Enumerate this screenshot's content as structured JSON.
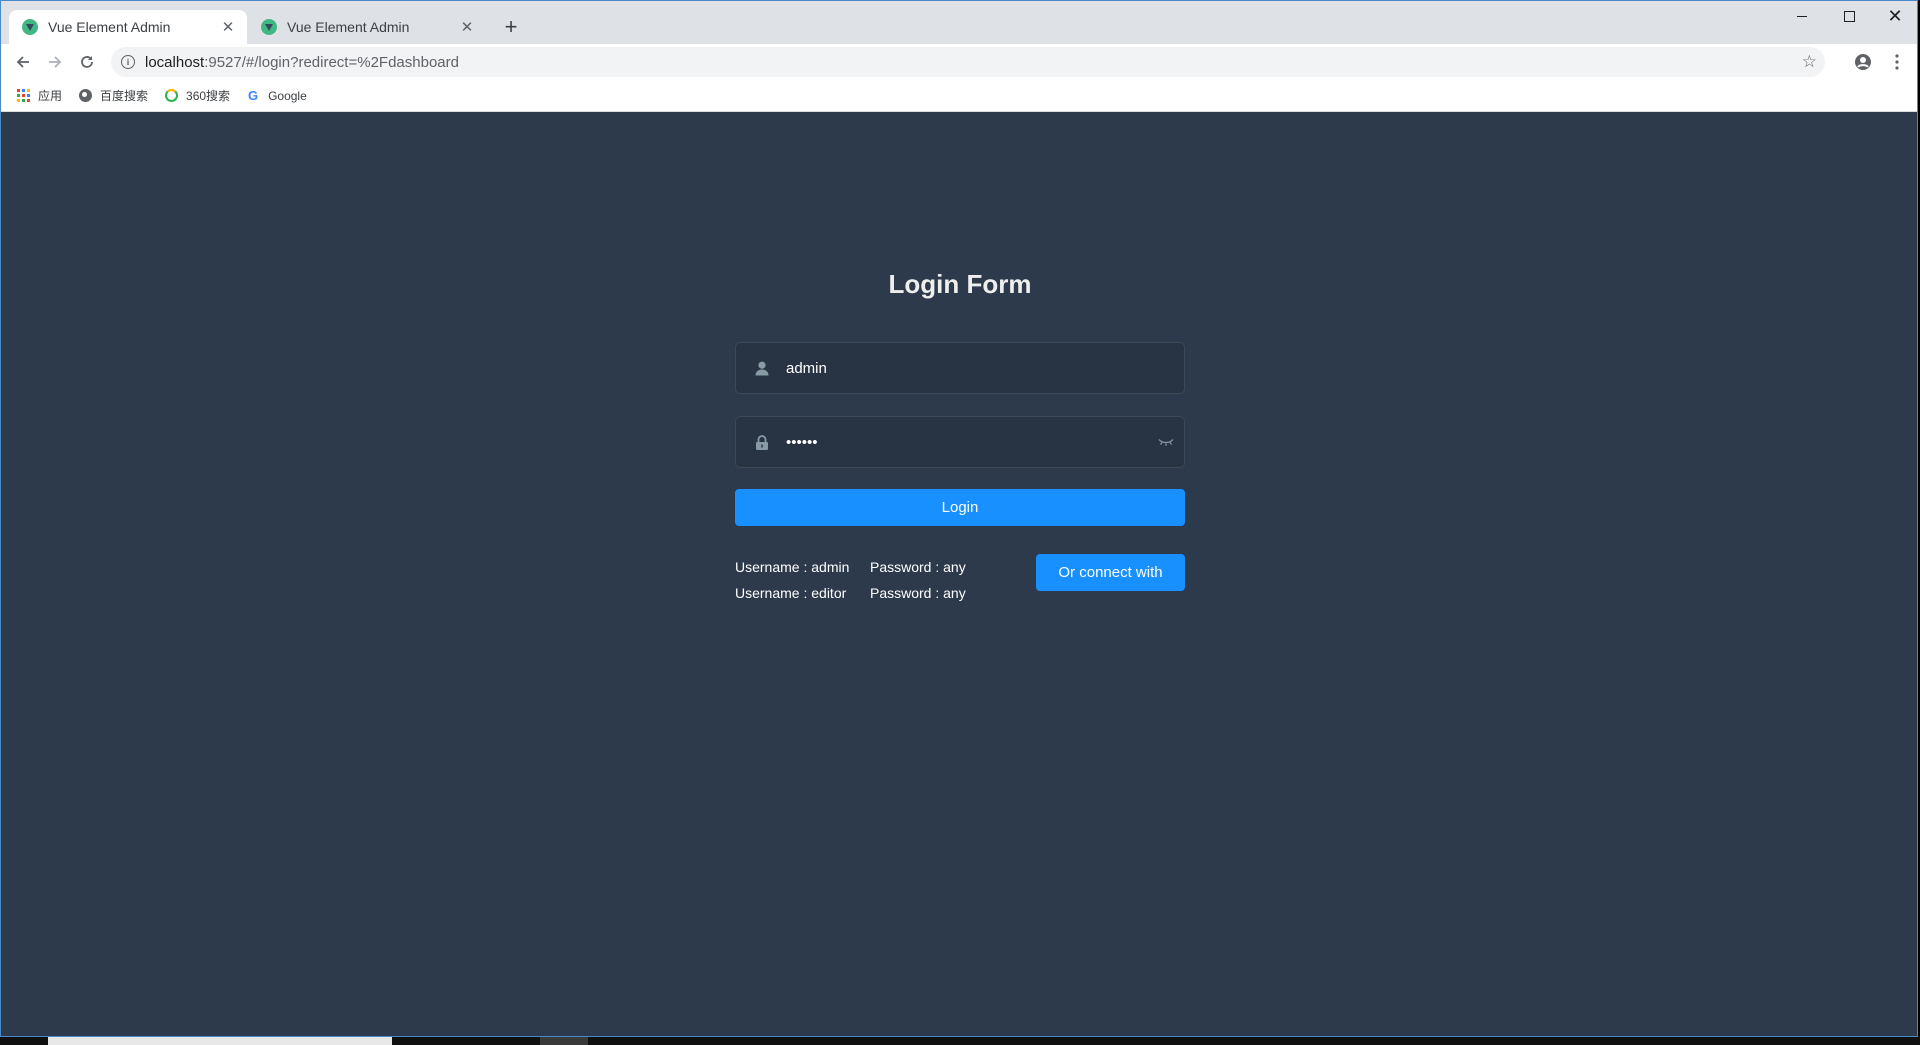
{
  "browser": {
    "tabs": [
      {
        "title": "Vue Element Admin",
        "active": true
      },
      {
        "title": "Vue Element Admin",
        "active": false
      }
    ],
    "url_host": "localhost",
    "url_rest": ":9527/#/login?redirect=%2Fdashboard",
    "bookmarks": [
      {
        "label": "应用",
        "icon": "apps-grid-icon"
      },
      {
        "label": "百度搜索",
        "icon": "globe-icon"
      },
      {
        "label": "360搜索",
        "icon": "360-icon"
      },
      {
        "label": "Google",
        "icon": "google-icon"
      }
    ]
  },
  "login": {
    "title": "Login Form",
    "username_value": "admin",
    "password_value": "111111",
    "login_button": "Login",
    "tips": [
      {
        "user": "Username : admin",
        "pass": "Password : any"
      },
      {
        "user": "Username : editor",
        "pass": "Password : any"
      }
    ],
    "connect_button": "Or connect with"
  },
  "colors": {
    "page_bg": "#2d3a4b",
    "primary": "#1890ff",
    "title": "#eeeeee",
    "icon_gray": "#889aa4"
  }
}
